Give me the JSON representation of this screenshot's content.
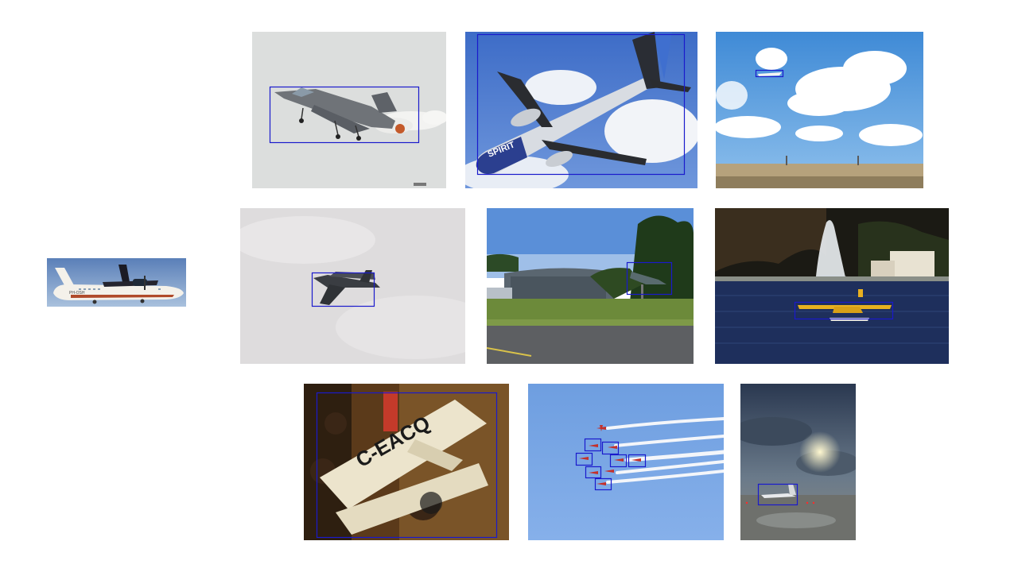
{
  "slide": {
    "background": "#ffffff",
    "bbox_color": "#1a1acc"
  },
  "query": {
    "subject": "fokker-turboprop-airliner",
    "livery_text": "PH-OSH"
  },
  "results": [
    {
      "subject": "gripen-fighter-jet-takeoff",
      "box_count": 1
    },
    {
      "subject": "spirit-airliner-underside",
      "livery_text": "SPIRIT",
      "box_count": 1
    },
    {
      "subject": "small-jet-over-clouds",
      "box_count": 1
    },
    {
      "subject": "c17-transport-in-overcast-sky",
      "box_count": 1
    },
    {
      "subject": "jet-on-pole-near-hangar",
      "box_count": 1
    },
    {
      "subject": "floatplane-by-fountain",
      "box_count": 1
    },
    {
      "subject": "vintage-biplane-in-museum",
      "livery_text": "C-EACQ",
      "box_count": 1
    },
    {
      "subject": "red-arrows-formation",
      "box_count": 7
    },
    {
      "subject": "business-jet-on-wet-tarmac",
      "box_count": 1
    }
  ]
}
